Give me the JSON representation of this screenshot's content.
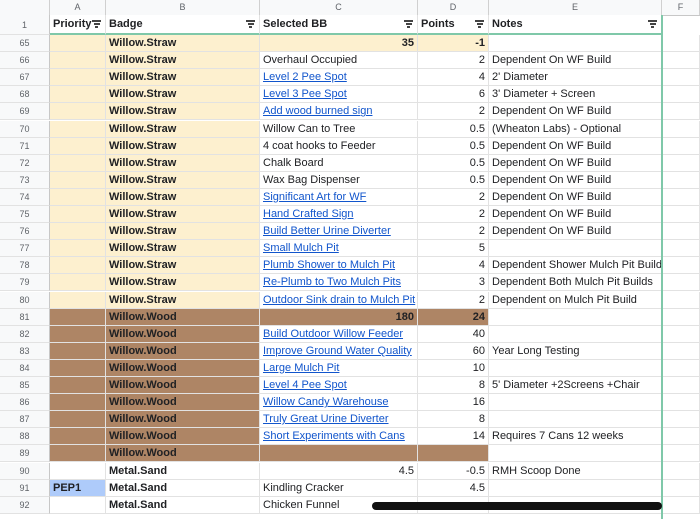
{
  "columns": [
    "A",
    "B",
    "C",
    "D",
    "E",
    "F"
  ],
  "header": {
    "rownum": "1",
    "priority": "Priority",
    "badge": "Badge",
    "selected": "Selected BB",
    "points": "Points",
    "notes": "Notes"
  },
  "colors": {
    "straw": "#fdf0cf",
    "wood": "#ae8565",
    "link": "#1155cc",
    "selection": "#aecbfa",
    "frozen_border": "#7fc8a9"
  },
  "rows": [
    {
      "num": "65",
      "priority": "",
      "badge": "Willow.Straw",
      "item": "",
      "link": false,
      "points": "-1",
      "notes": "",
      "style": "straw",
      "summary": "35"
    },
    {
      "num": "66",
      "priority": "",
      "badge": "Willow.Straw",
      "item": "Overhaul Occupied",
      "link": false,
      "points": "2",
      "notes": "Dependent On WF Build",
      "style": "straw"
    },
    {
      "num": "67",
      "priority": "",
      "badge": "Willow.Straw",
      "item": "Level 2 Pee Spot",
      "link": true,
      "points": "4",
      "notes": "2' Diameter",
      "style": "straw"
    },
    {
      "num": "68",
      "priority": "",
      "badge": "Willow.Straw",
      "item": "Level 3 Pee Spot",
      "link": true,
      "points": "6",
      "notes": "3' Diameter + Screen",
      "style": "straw"
    },
    {
      "num": "69",
      "priority": "",
      "badge": "Willow.Straw",
      "item": "Add wood burned sign",
      "link": true,
      "points": "2",
      "notes": "Dependent On WF Build",
      "style": "straw"
    },
    {
      "num": "70",
      "priority": "",
      "badge": "Willow.Straw",
      "item": "Willow Can to Tree",
      "link": false,
      "points": "0.5",
      "notes": "(Wheaton Labs) - Optional",
      "style": "straw"
    },
    {
      "num": "71",
      "priority": "",
      "badge": "Willow.Straw",
      "item": "4 coat hooks to Feeder",
      "link": false,
      "points": "0.5",
      "notes": "Dependent On WF Build",
      "style": "straw"
    },
    {
      "num": "72",
      "priority": "",
      "badge": "Willow.Straw",
      "item": "Chalk Board",
      "link": false,
      "points": "0.5",
      "notes": "Dependent On WF Build",
      "style": "straw"
    },
    {
      "num": "73",
      "priority": "",
      "badge": "Willow.Straw",
      "item": "Wax Bag Dispenser",
      "link": false,
      "points": "0.5",
      "notes": "Dependent On WF Build",
      "style": "straw"
    },
    {
      "num": "74",
      "priority": "",
      "badge": "Willow.Straw",
      "item": "Significant Art for WF",
      "link": true,
      "points": "2",
      "notes": "Dependent On WF Build",
      "style": "straw"
    },
    {
      "num": "75",
      "priority": "",
      "badge": "Willow.Straw",
      "item": "Hand Crafted Sign",
      "link": true,
      "points": "2",
      "notes": "Dependent On WF Build",
      "style": "straw"
    },
    {
      "num": "76",
      "priority": "",
      "badge": "Willow.Straw",
      "item": "Build Better Urine Diverter",
      "link": true,
      "points": "2",
      "notes": "Dependent On WF Build",
      "style": "straw"
    },
    {
      "num": "77",
      "priority": "",
      "badge": "Willow.Straw",
      "item": "Small Mulch Pit",
      "link": true,
      "points": "5",
      "notes": "",
      "style": "straw"
    },
    {
      "num": "78",
      "priority": "",
      "badge": "Willow.Straw",
      "item": "Plumb Shower to Mulch Pit",
      "link": true,
      "points": "4",
      "notes": "Dependent Shower Mulch Pit Builds",
      "style": "straw"
    },
    {
      "num": "79",
      "priority": "",
      "badge": "Willow.Straw",
      "item": "Re-Plumb to Two Mulch Pits",
      "link": true,
      "points": "3",
      "notes": "Dependent Both Mulch Pit Builds",
      "style": "straw"
    },
    {
      "num": "80",
      "priority": "",
      "badge": "Willow.Straw",
      "item": "Outdoor Sink drain to Mulch Pit",
      "link": true,
      "points": "2",
      "notes": "Dependent on Mulch Pit Build",
      "style": "straw"
    },
    {
      "num": "81",
      "priority": "",
      "badge": "Willow.Wood",
      "item": "",
      "link": false,
      "points": "24",
      "notes": "",
      "style": "wood",
      "summary": "180"
    },
    {
      "num": "82",
      "priority": "",
      "badge": "Willow.Wood",
      "item": "Build Outdoor Willow Feeder",
      "link": true,
      "points": "40",
      "notes": "",
      "style": "wood"
    },
    {
      "num": "83",
      "priority": "",
      "badge": "Willow.Wood",
      "item": "Improve Ground Water Quality",
      "link": true,
      "points": "60",
      "notes": "Year Long Testing",
      "style": "wood"
    },
    {
      "num": "84",
      "priority": "",
      "badge": "Willow.Wood",
      "item": "Large Mulch Pit",
      "link": true,
      "points": "10",
      "notes": "",
      "style": "wood"
    },
    {
      "num": "85",
      "priority": "",
      "badge": "Willow.Wood",
      "item": "Level 4 Pee Spot",
      "link": true,
      "points": "8",
      "notes": "5' Diameter +2Screens +Chair",
      "style": "wood"
    },
    {
      "num": "86",
      "priority": "",
      "badge": "Willow.Wood",
      "item": "Willow Candy Warehouse",
      "link": true,
      "points": "16",
      "notes": "",
      "style": "wood"
    },
    {
      "num": "87",
      "priority": "",
      "badge": "Willow.Wood",
      "item": "Truly Great Urine Diverter",
      "link": true,
      "points": "8",
      "notes": "",
      "style": "wood"
    },
    {
      "num": "88",
      "priority": "",
      "badge": "Willow.Wood",
      "item": "Short Experiments with Cans",
      "link": true,
      "points": "14",
      "notes": "Requires 7 Cans 12 weeks",
      "style": "wood"
    },
    {
      "num": "89",
      "priority": "",
      "badge": "Willow.Wood",
      "item": "",
      "link": false,
      "points": "",
      "notes": "",
      "style": "woodfull"
    },
    {
      "num": "90",
      "priority": "",
      "badge": "Metal.Sand",
      "item": "",
      "link": false,
      "points": "-0.5",
      "notes": "RMH Scoop Done",
      "style": "plain",
      "summary": "4.5"
    },
    {
      "num": "91",
      "priority": "PEP1",
      "badge": "Metal.Sand",
      "item": "Kindling Cracker",
      "link": false,
      "points": "4.5",
      "notes": "",
      "style": "plain",
      "selected": true
    },
    {
      "num": "92",
      "priority": "",
      "badge": "Metal.Sand",
      "item": "Chicken Funnel",
      "link": false,
      "points": "",
      "notes": "",
      "style": "plain"
    }
  ]
}
